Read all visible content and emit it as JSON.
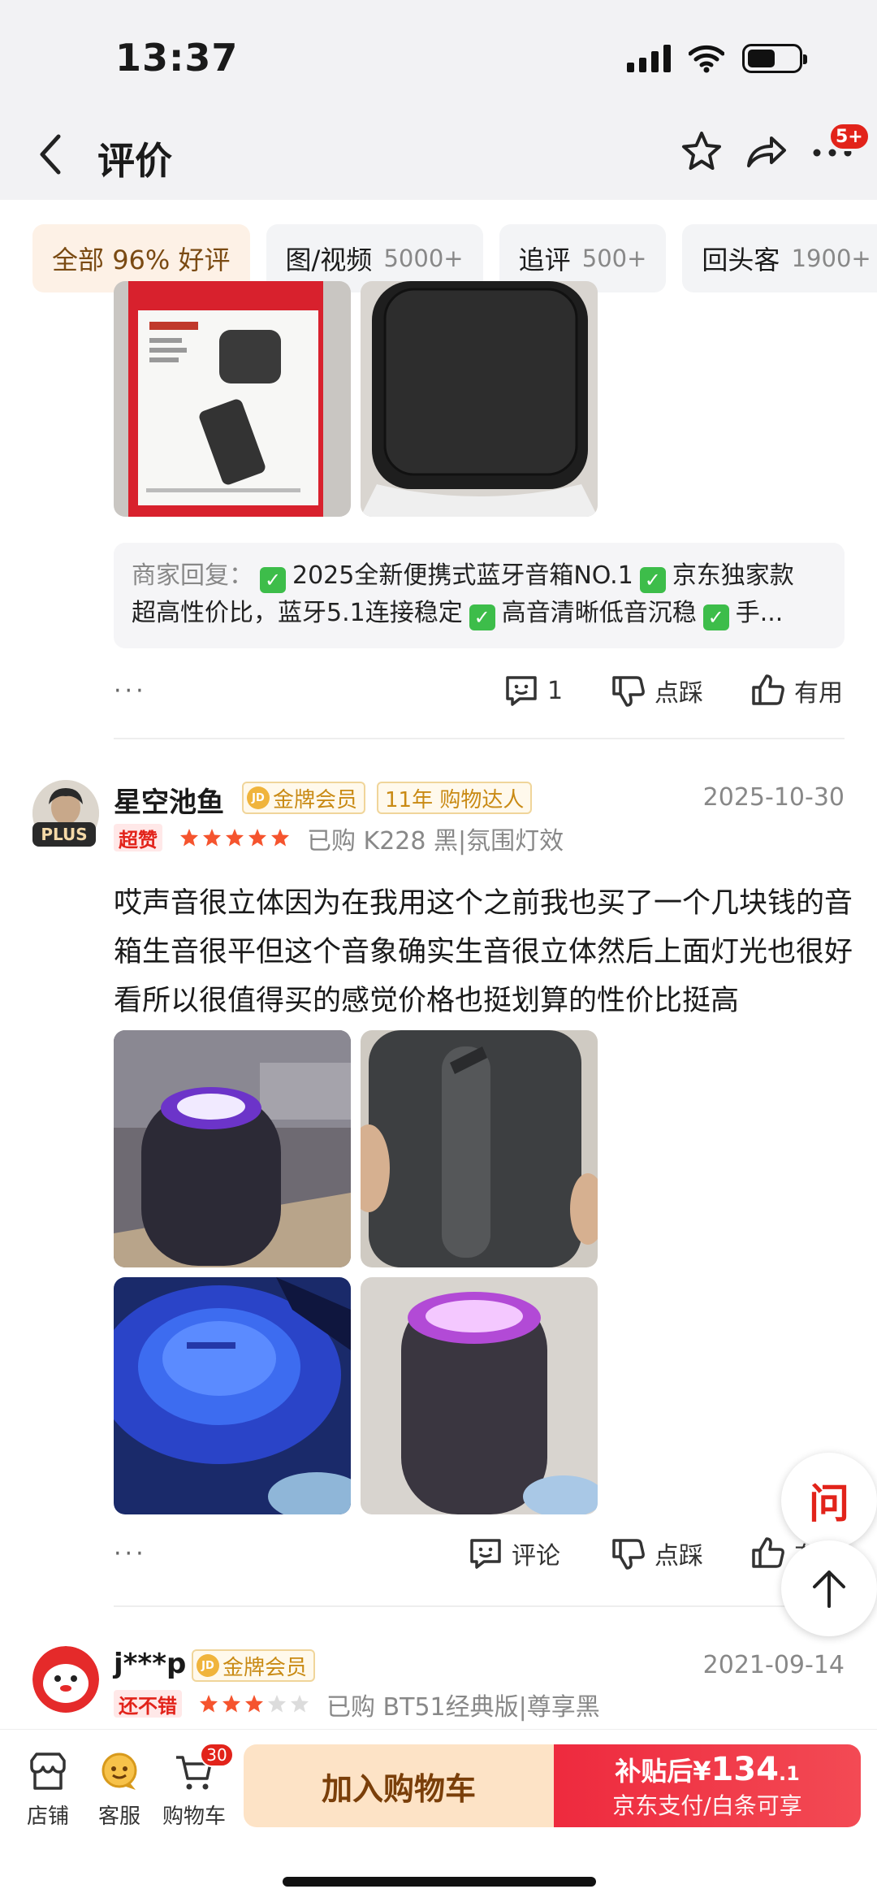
{
  "status_bar": {
    "time": "13:37"
  },
  "header": {
    "title": "评价",
    "more_badge": "5+"
  },
  "filters": [
    {
      "label": "全部",
      "count": "96% 好评",
      "active": true
    },
    {
      "label": "图/视频",
      "count": "5000+",
      "active": false
    },
    {
      "label": "追评",
      "count": "500+",
      "active": false
    },
    {
      "label": "回头客",
      "count": "1900+",
      "active": false
    }
  ],
  "review0": {
    "merchant_reply_label": "商家回复：",
    "merchant_reply_line1_a": "2025全新便携式蓝牙音箱NO.1",
    "merchant_reply_line1_b": "京东独家款",
    "merchant_reply_line2_a": "超高性价比，蓝牙5.1连接稳定",
    "merchant_reply_line2_b": "高音清晰低音沉稳",
    "merchant_reply_line2_c": "手...",
    "comment_count": "1",
    "dislike_label": "点踩",
    "useful_label": "有用"
  },
  "review1": {
    "username": "星空池鱼",
    "plus_label": "PLUS",
    "member_label": "金牌会员",
    "tag_label": "11年 购物达人",
    "date": "2025-10-30",
    "rating_label": "超赞",
    "rating": 5,
    "bought": "已购 K228 黑|氛围灯效",
    "content": "哎声音很立体因为在我用这个之前我也买了一个几块钱的音箱生音很平但这个音象确实生音很立体然后上面灯光也很好看所以很值得买的感觉价格也挺划算的性价比挺高",
    "comment_label": "评论",
    "dislike_label": "点踩",
    "useful_label": "有用"
  },
  "review2": {
    "username": "j***p",
    "member_label": "金牌会员",
    "date": "2021-09-14",
    "rating_label": "还不错",
    "rating": 3,
    "bought": "已购 BT51经典版|尊享黑"
  },
  "float": {
    "ask_label": "问"
  },
  "bottom_bar": {
    "shop_label": "店铺",
    "service_label": "客服",
    "cart_label": "购物车",
    "cart_badge": "30",
    "add_to_cart_label": "加入购物车",
    "buy_prefix": "补贴后¥",
    "buy_price_int": "134",
    "buy_price_dec": ".1",
    "buy_sub": "京东支付/白条可享"
  },
  "colors": {
    "accent": "#e2231a",
    "gold": "#c98a14",
    "add_cart_bg": "#fde3c6"
  }
}
